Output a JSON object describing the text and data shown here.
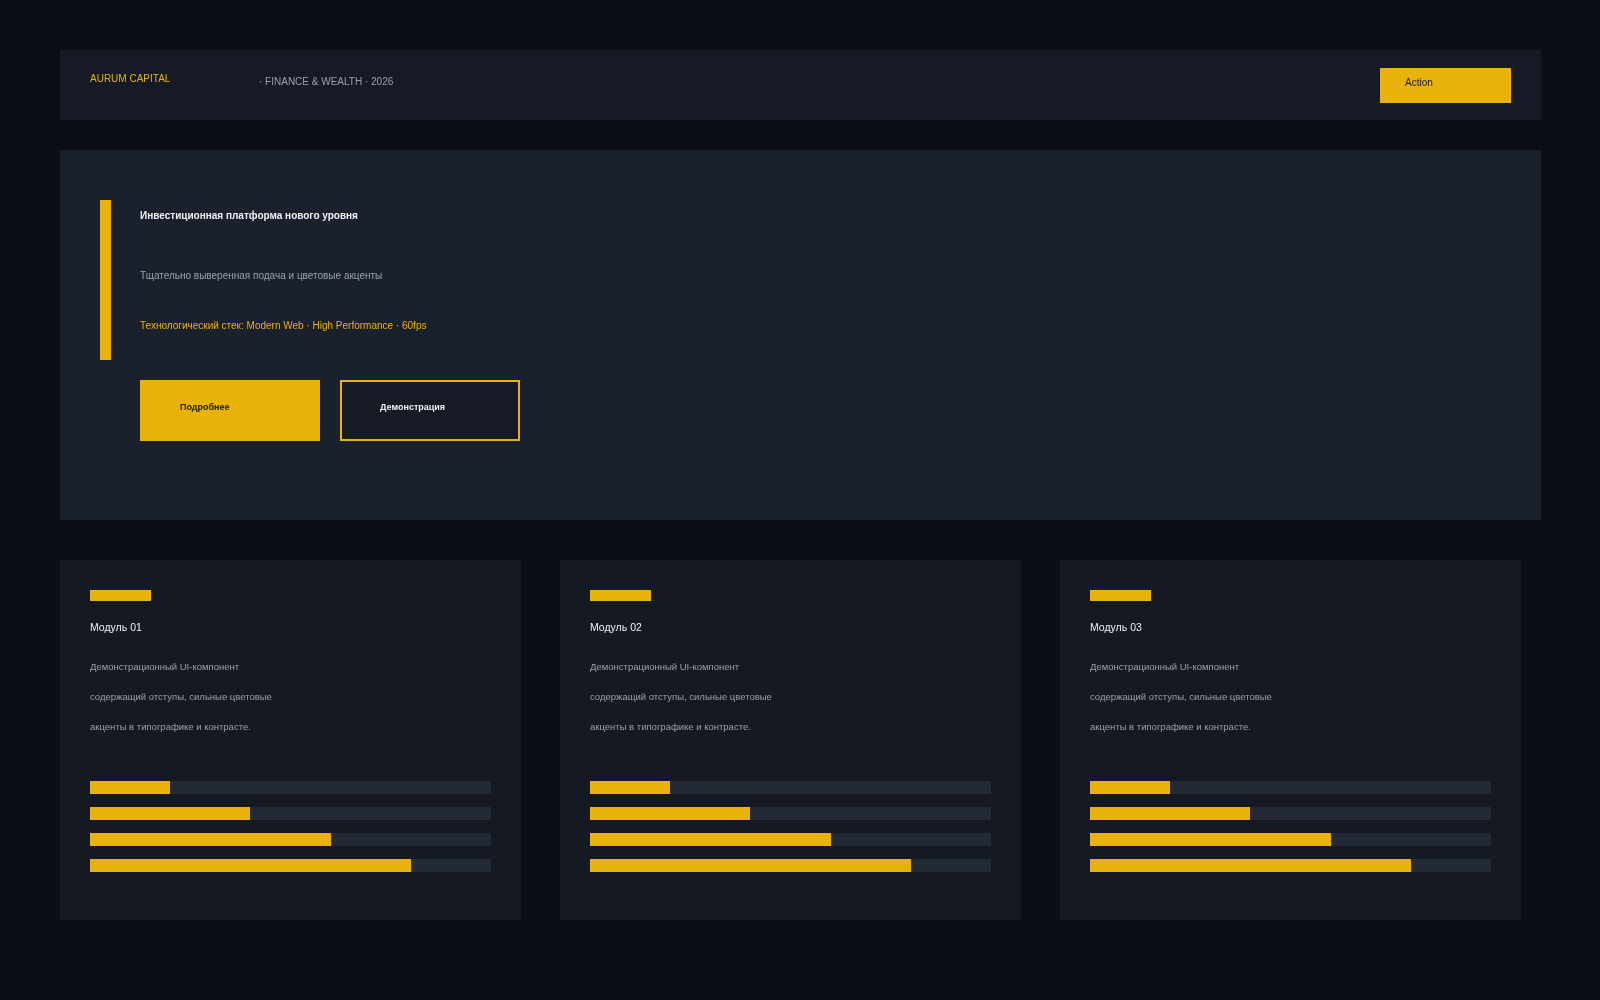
{
  "header": {
    "logo": "AURUM CAPITAL",
    "tagline": "· FINANCE & WEALTH · 2026",
    "action_button": "Action"
  },
  "hero": {
    "title": "Инвестиционная платформа нового уровня",
    "subtitle": "Тщательно выверенная подача и цветовые акценты",
    "tech_line": "Технологический стек: Modern Web · High Performance · 60fps",
    "buttons": [
      {
        "label": "Подробнее",
        "kind": "primary"
      },
      {
        "label": "Демонстрация",
        "kind": "secondary"
      }
    ]
  },
  "cards": [
    {
      "title": "Модуль 01",
      "description": "Демонстрационный UI-компонент содержащий отступы, сильные цветовые акценты в типографике и контрасте.",
      "bars": [
        {
          "level": 0.2
        },
        {
          "level": 0.4
        },
        {
          "level": 0.6
        },
        {
          "level": 0.8
        }
      ]
    },
    {
      "title": "Модуль 02",
      "description": "Демонстрационный UI-компонент содержащий отступы, сильные цветовые акценты в типографике и контрасте.",
      "bars": [
        {
          "level": 0.2
        },
        {
          "level": 0.4
        },
        {
          "level": 0.6
        },
        {
          "level": 0.8
        }
      ]
    },
    {
      "title": "Модуль 03",
      "description": "Демонстрационный UI-компонент содержащий отступы, сильные цветовые акценты в типографике и контрасте.",
      "bars": [
        {
          "level": 0.2
        },
        {
          "level": 0.4
        },
        {
          "level": 0.6
        },
        {
          "level": 0.8
        }
      ]
    }
  ]
}
